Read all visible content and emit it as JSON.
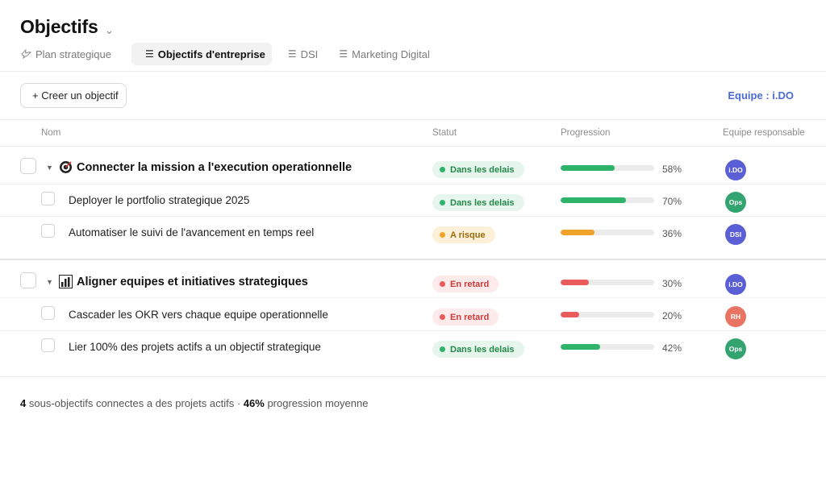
{
  "page": {
    "title": "Objectifs",
    "title_chevron": "⌄",
    "tabs": [
      {
        "label": "Plan strategique",
        "icon": "dove-icon",
        "glyph": "🕊",
        "active": false
      },
      {
        "label": "Objectifs d'entreprise",
        "icon": "list-icon",
        "glyph": "☰",
        "active": true
      },
      {
        "label": "DSI",
        "icon": "list-icon",
        "glyph": "☰",
        "active": false
      },
      {
        "label": "Marketing Digital",
        "icon": "list-icon",
        "glyph": "☰",
        "active": false
      }
    ]
  },
  "toolbar": {
    "create_label": "+ Creer un objectif",
    "team_filter": "Equipe : i.DO"
  },
  "columns": {
    "name": "Nom",
    "status": "Statut",
    "progress": "Progression",
    "team": "Equipe responsable"
  },
  "groups": [
    {
      "name": "Connecter la mission a l'execution operationnelle",
      "icon": "target-icon",
      "status": "Dans les delais",
      "progress": 58,
      "progress_label": "58%",
      "team": "i.DO",
      "children": [
        {
          "name": "Deployer le portfolio strategique 2025",
          "status": "Dans les delais",
          "progress": 70,
          "progress_label": "70%",
          "team": "Ops"
        },
        {
          "name": "Automatiser le suivi de l'avancement en temps reel",
          "status": "A risque",
          "progress": 36,
          "progress_label": "36%",
          "team": "DSI"
        }
      ]
    },
    {
      "name": "Aligner equipes et initiatives strategiques",
      "icon": "bar-chart-icon",
      "status": "En retard",
      "progress": 30,
      "progress_label": "30%",
      "team": "i.DO",
      "children": [
        {
          "name": "Cascader les OKR vers chaque equipe operationnelle",
          "status": "En retard",
          "progress": 20,
          "progress_label": "20%",
          "team": "RH"
        },
        {
          "name": "Lier 100% des projets actifs a un objectif strategique",
          "status": "Dans les delais",
          "progress": 42,
          "progress_label": "42%",
          "team": "Ops"
        }
      ]
    }
  ],
  "footer": {
    "count": "4",
    "count_text": "sous-objectifs connectes a des projets actifs ·",
    "avg": "46%",
    "avg_text": "progression moyenne"
  },
  "colors": {
    "accent": "#4c6bd6",
    "on_track": "#2fb36a",
    "at_risk": "#f1a22a",
    "late": "#ea5b5b",
    "team_ido": "#5b5fd6",
    "team_ops": "#33a36f",
    "team_dsi": "#5b5fd6",
    "team_rh": "#ea7464"
  }
}
